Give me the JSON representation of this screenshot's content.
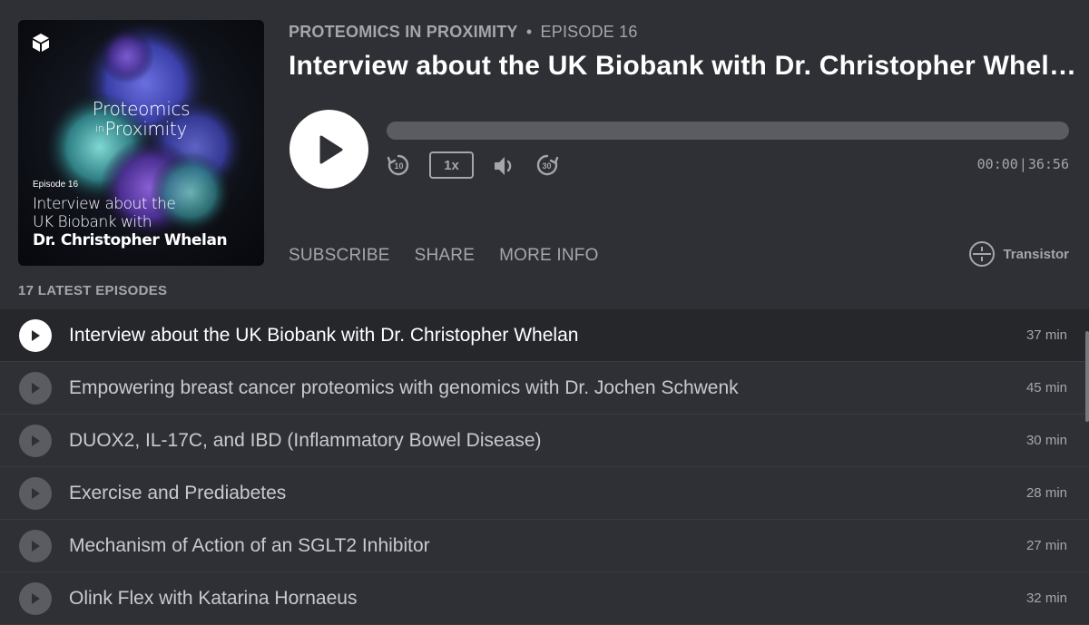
{
  "artwork": {
    "title_line1": "Proteomics",
    "title_in": "in",
    "title_line2": "Proximity",
    "episode_label": "Episode 16",
    "subtitle_line1": "Interview about the",
    "subtitle_line2": "UK Biobank with",
    "subtitle_line3": "Dr. Christopher Whelan",
    "logo_icon": "olink-logo-icon"
  },
  "header": {
    "show_name": "PROTEOMICS IN PROXIMITY",
    "separator": "•",
    "episode_number": "EPISODE 16",
    "episode_title": "Interview about the UK Biobank with Dr. Christopher Whelan"
  },
  "player": {
    "play_icon": "play-icon",
    "progress_fraction": 0,
    "skip_back_label": "10",
    "speed_label": "1x",
    "skip_forward_label": "30",
    "current_time": "00:00",
    "time_separator": "|",
    "duration": "36:56"
  },
  "links": {
    "subscribe": "SUBSCRIBE",
    "share": "SHARE",
    "more_info": "MORE INFO"
  },
  "brand": {
    "name": "Transistor",
    "icon": "transistor-logo-icon"
  },
  "episodes": {
    "heading": "17 LATEST EPISODES",
    "items": [
      {
        "title": "Interview about the UK Biobank with Dr. Christopher Whelan",
        "duration": "37 min",
        "active": true
      },
      {
        "title": "Empowering breast cancer proteomics with genomics with Dr. Jochen Schwenk",
        "duration": "45 min",
        "active": false
      },
      {
        "title": "DUOX2, IL-17C, and IBD (Inflammatory Bowel Disease)",
        "duration": "30 min",
        "active": false
      },
      {
        "title": "Exercise and Prediabetes",
        "duration": "28 min",
        "active": false
      },
      {
        "title": "Mechanism of Action of an SGLT2 Inhibitor",
        "duration": "27 min",
        "active": false
      },
      {
        "title": "Olink Flex with Katarina Hornaeus",
        "duration": "32 min",
        "active": false
      }
    ]
  },
  "colors": {
    "background": "#2f3035",
    "active_row": "#26272b",
    "muted_text": "#a5a6ab",
    "progress_track": "#5b5c61"
  }
}
